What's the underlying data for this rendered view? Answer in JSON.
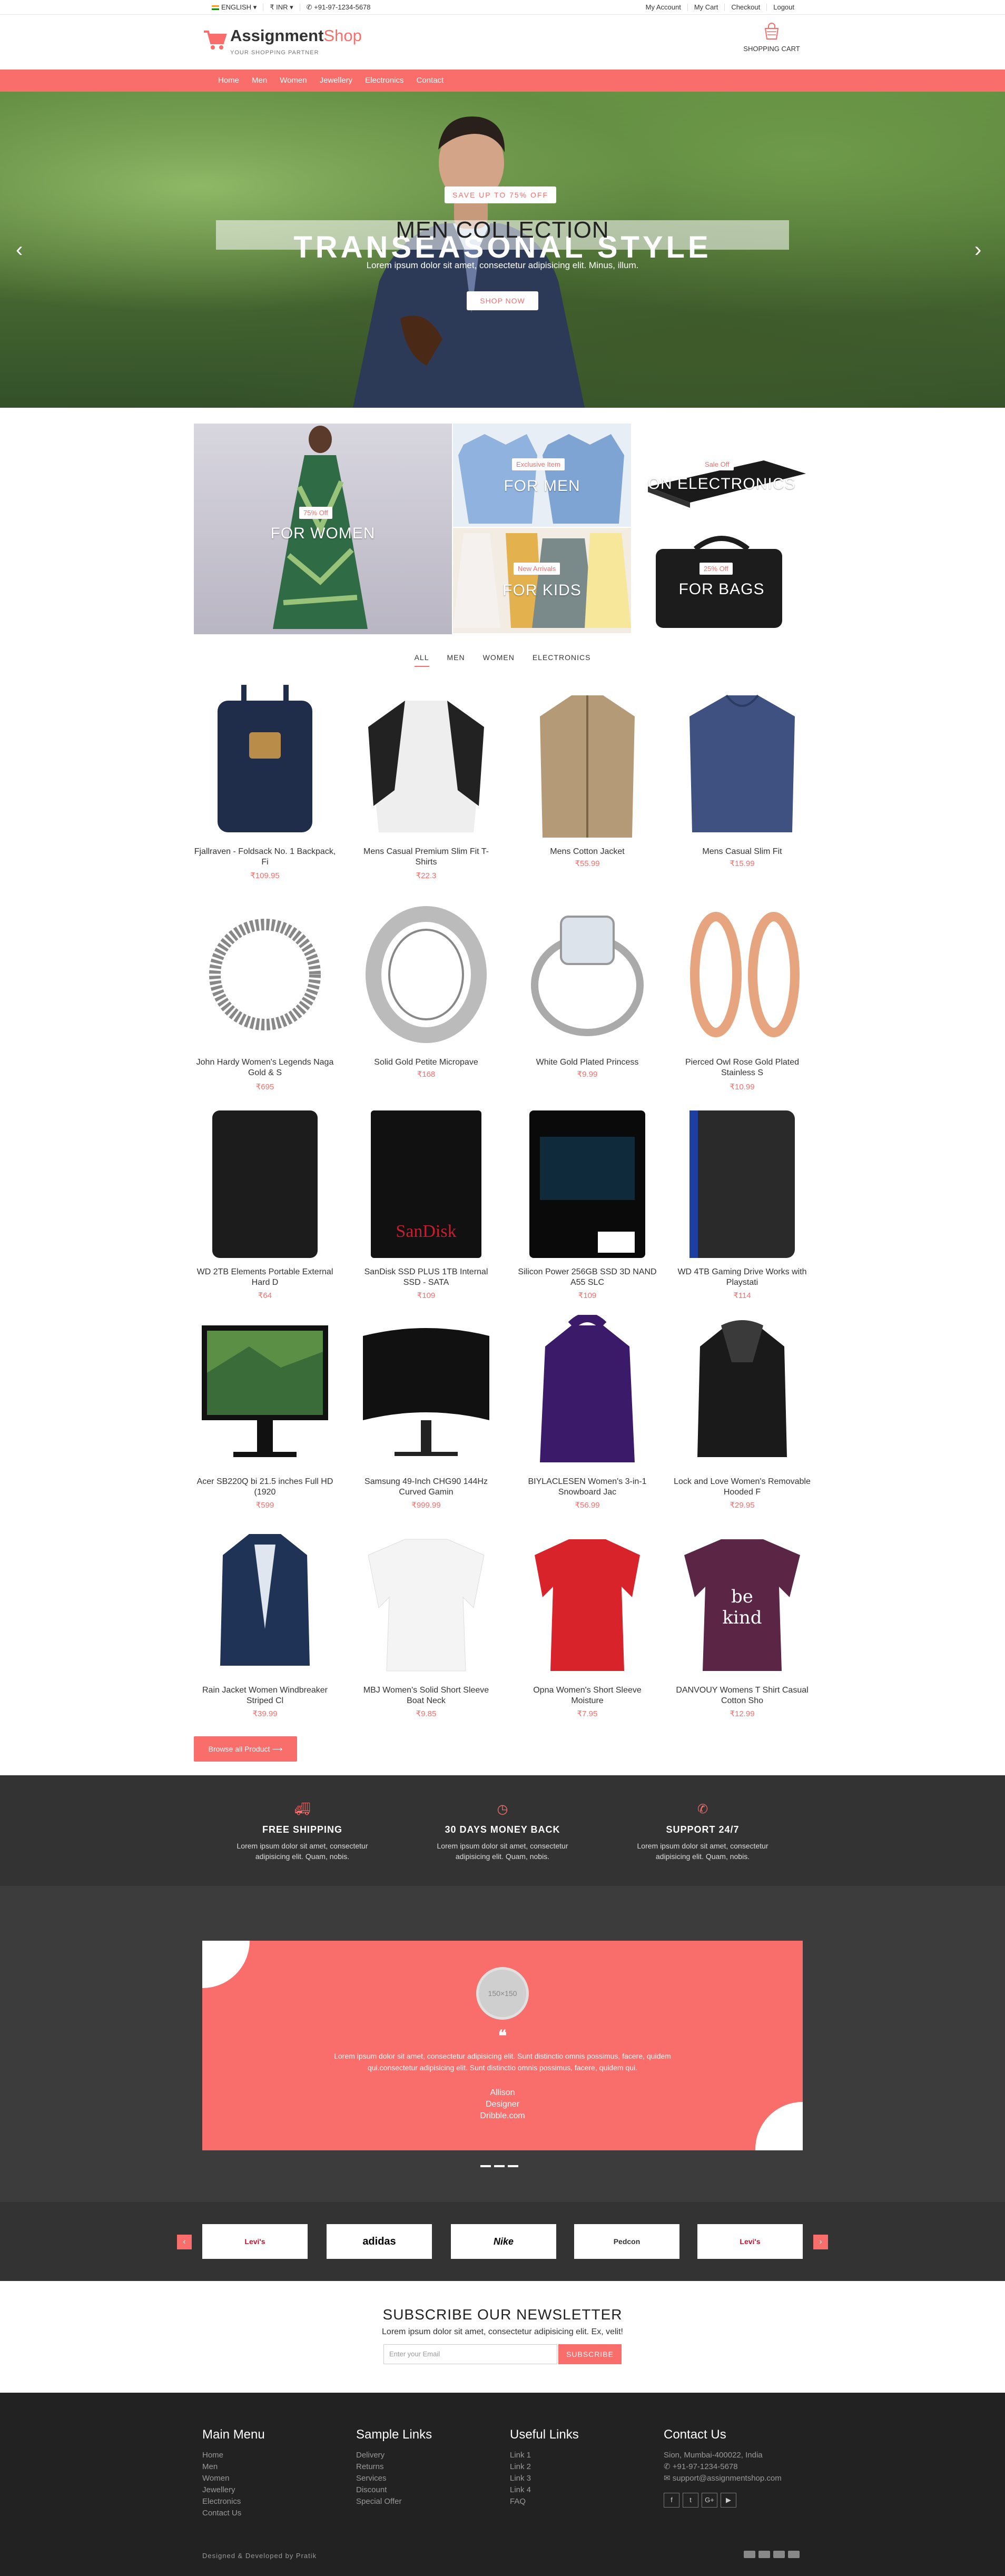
{
  "topbar": {
    "language": "ENGLISH",
    "currency": "₹ INR",
    "phone": "+91-97-1234-5678",
    "links": [
      "My Account",
      "My Cart",
      "Checkout",
      "Logout"
    ]
  },
  "header": {
    "logo_main": "Assignment",
    "logo_accent": "Shop",
    "tagline": "YOUR SHOPPING PARTNER",
    "cart_label": "SHOPPING CART"
  },
  "nav": [
    "Home",
    "Men",
    "Women",
    "Jewellery",
    "Electronics",
    "Contact"
  ],
  "hero": {
    "badge": "SAVE UP TO 75% OFF",
    "title_dark": "MEN COLLECTION",
    "title_light": "TRANSEASONAL STYLE",
    "subtitle": "Lorem ipsum dolor sit amet, consectetur adipisicing elit. Minus, illum.",
    "button": "SHOP NOW"
  },
  "categories": [
    {
      "pill": "75% Off",
      "label": "FOR WOMEN"
    },
    {
      "pill": "Exclusive Item",
      "label": "FOR MEN"
    },
    {
      "pill": "Sale Off",
      "label": "ON ELECTRONICS"
    },
    {
      "pill": "New Arrivals",
      "label": "FOR KIDS"
    },
    {
      "pill": "25% Off",
      "label": "FOR BAGS"
    }
  ],
  "filter_tabs": [
    "ALL",
    "MEN",
    "WOMEN",
    "ELECTRONICS"
  ],
  "products": [
    {
      "name": "Fjallraven - Foldsack No. 1 Backpack, Fi",
      "price": "₹109.95"
    },
    {
      "name": "Mens Casual Premium Slim Fit T-Shirts",
      "price": "₹22.3"
    },
    {
      "name": "Mens Cotton Jacket",
      "price": "₹55.99"
    },
    {
      "name": "Mens Casual Slim Fit",
      "price": "₹15.99"
    },
    {
      "name": "John Hardy Women's Legends Naga Gold & S",
      "price": "₹695"
    },
    {
      "name": "Solid Gold Petite Micropave",
      "price": "₹168"
    },
    {
      "name": "White Gold Plated Princess",
      "price": "₹9.99"
    },
    {
      "name": "Pierced Owl Rose Gold Plated Stainless S",
      "price": "₹10.99"
    },
    {
      "name": "WD 2TB Elements Portable External Hard D",
      "price": "₹64"
    },
    {
      "name": "SanDisk SSD PLUS 1TB Internal SSD - SATA",
      "price": "₹109"
    },
    {
      "name": "Silicon Power 256GB SSD 3D NAND A55 SLC",
      "price": "₹109"
    },
    {
      "name": "WD 4TB Gaming Drive Works with Playstati",
      "price": "₹114"
    },
    {
      "name": "Acer SB220Q bi 21.5 inches Full HD (1920",
      "price": "₹599"
    },
    {
      "name": "Samsung 49-Inch CHG90 144Hz Curved Gamin",
      "price": "₹999.99"
    },
    {
      "name": "BIYLACLESEN Women's 3-in-1 Snowboard Jac",
      "price": "₹56.99"
    },
    {
      "name": "Lock and Love Women's Removable Hooded F",
      "price": "₹29.95"
    },
    {
      "name": "Rain Jacket Women Windbreaker Striped Cl",
      "price": "₹39.99"
    },
    {
      "name": "MBJ Women's Solid Short Sleeve Boat Neck",
      "price": "₹9.85"
    },
    {
      "name": "Opna Women's Short Sleeve Moisture",
      "price": "₹7.95"
    },
    {
      "name": "DANVOUY Womens T Shirt Casual Cotton Sho",
      "price": "₹12.99"
    }
  ],
  "browse_button": "Browse all Product",
  "services": [
    {
      "title": "FREE SHIPPING",
      "desc": "Lorem ipsum dolor sit amet, consectetur adipisicing elit. Quam, nobis."
    },
    {
      "title": "30 DAYS MONEY BACK",
      "desc": "Lorem ipsum dolor sit amet, consectetur adipisicing elit. Quam, nobis."
    },
    {
      "title": "SUPPORT 24/7",
      "desc": "Lorem ipsum dolor sit amet, consectetur adipisicing elit. Quam, nobis."
    }
  ],
  "testimonial": {
    "avatar": "150×150",
    "quote_mark": "❝",
    "text": "Lorem ipsum dolor sit amet, consectetur adipisicing elit. Sunt distinctio omnis possimus, facere, quidem qui.consectetur adipisicing elit. Sunt distinctio omnis possimus, facere, quidem qui.",
    "name": "Allison",
    "role": "Designer",
    "site": "Dribble.com"
  },
  "brands": [
    "Levi's",
    "adidas",
    "Nike",
    "Pedcon",
    "Levi's"
  ],
  "newsletter": {
    "title": "SUBSCRIBE OUR NEWSLETTER",
    "subtitle": "Lorem ipsum dolor sit amet, consectetur adipisicing elit. Ex, velit!",
    "placeholder": "Enter your Email",
    "button": "SUBSCRIBE"
  },
  "footer": {
    "main_menu": {
      "title": "Main Menu",
      "items": [
        "Home",
        "Men",
        "Women",
        "Jewellery",
        "Electronics",
        "Contact Us"
      ]
    },
    "sample_links": {
      "title": "Sample Links",
      "items": [
        "Delivery",
        "Returns",
        "Services",
        "Discount",
        "Special Offer"
      ]
    },
    "useful_links": {
      "title": "Useful Links",
      "items": [
        "Link 1",
        "Link 2",
        "Link 3",
        "Link 4",
        "FAQ"
      ]
    },
    "contact": {
      "title": "Contact Us",
      "address": "Sion, Mumbai-400022, India",
      "phone": "+91-97-1234-5678",
      "email": "support@assignmentshop.com"
    },
    "social": [
      "f",
      "t",
      "G+",
      "▶"
    ],
    "credit": "Designed & Developed by Pratik"
  },
  "colors": {
    "accent": "#f96d6a",
    "dark": "#333333",
    "footer": "#222222"
  }
}
